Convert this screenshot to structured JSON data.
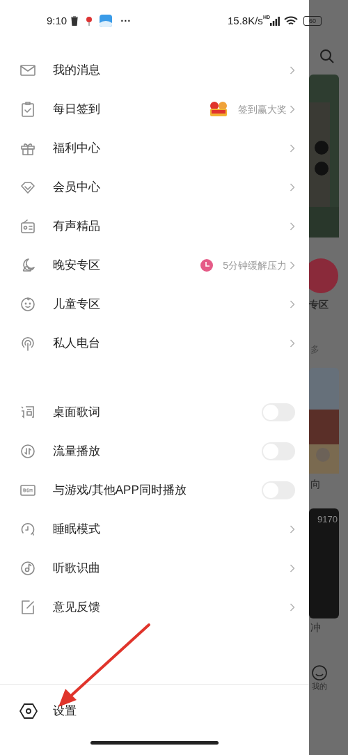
{
  "status_bar": {
    "time": "9:10",
    "more": "···",
    "speed": "15.8K/s",
    "network": "HD",
    "battery": "60"
  },
  "menu": [
    {
      "kind": "link",
      "label": "我的消息"
    },
    {
      "kind": "link",
      "label": "每日签到",
      "extra": {
        "kind": "gift",
        "text": "签到赢大奖"
      }
    },
    {
      "kind": "link",
      "label": "福利中心"
    },
    {
      "kind": "link",
      "label": "会员中心"
    },
    {
      "kind": "link",
      "label": "有声精品"
    },
    {
      "kind": "link",
      "label": "晚安专区",
      "extra": {
        "kind": "clock",
        "text": "5分钟缓解压力"
      }
    },
    {
      "kind": "link",
      "label": "儿童专区"
    },
    {
      "kind": "link",
      "label": "私人电台"
    }
  ],
  "settings_list": [
    {
      "kind": "toggle",
      "label": "桌面歌词",
      "on": false
    },
    {
      "kind": "toggle",
      "label": "流量播放",
      "on": false
    },
    {
      "kind": "toggle",
      "label": "与游戏/其他APP同时播放",
      "on": false
    },
    {
      "kind": "link",
      "label": "睡眠模式"
    },
    {
      "kind": "link",
      "label": "听歌识曲"
    },
    {
      "kind": "link",
      "label": "意见反馈"
    }
  ],
  "footer": {
    "label": "设置"
  },
  "background_app": {
    "zone_label": "专区",
    "more_link": "多",
    "card_title": "向",
    "play_count": "9170",
    "card_title_2": "冲",
    "tab_label": "我的"
  }
}
